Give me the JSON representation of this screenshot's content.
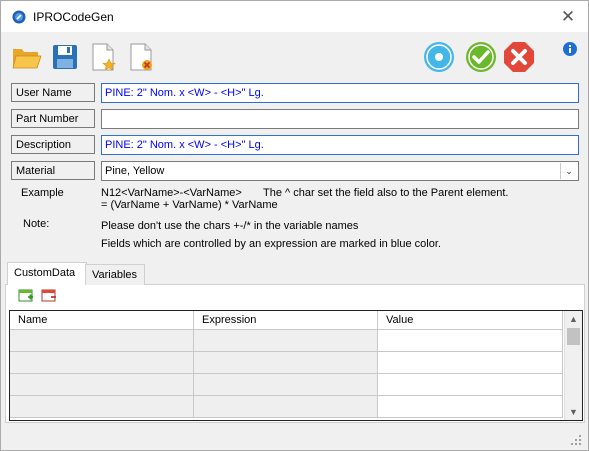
{
  "window": {
    "title": "IPROCodeGen"
  },
  "toolbar": {
    "open": "open-folder-icon",
    "save": "save-disk-icon",
    "new": "new-document-star-icon",
    "delete": "delete-document-icon",
    "status_blue": "info-circle-icon",
    "ok": "ok-check-icon",
    "cancel": "cancel-x-icon",
    "info": "info-icon"
  },
  "fields": {
    "user_name": {
      "label": "User Name",
      "value": "PINE: 2\" Nom. x <W> - <H>\" Lg."
    },
    "part_number": {
      "label": "Part Number",
      "value": ""
    },
    "description": {
      "label": "Description",
      "value": "PINE: 2\" Nom. x <W> - <H>\" Lg."
    },
    "material": {
      "label": "Material",
      "value": "Pine, Yellow"
    }
  },
  "notes": {
    "example_label": "Example",
    "example_line1": "N12<VarName>-<VarName>",
    "example_line1b": "The ^ char set the field also to the Parent element.",
    "example_line2": "= (VarName + VarName) * VarName",
    "note_label": "Note:",
    "note_line1": "Please don't use the chars +-/* in the variable names",
    "note_line2": "Fields which are controlled by an expression are marked in blue color."
  },
  "tabs": [
    {
      "label": "CustomData"
    },
    {
      "label": "Variables"
    }
  ],
  "grid": {
    "columns": [
      "Name",
      "Expression",
      "Value"
    ]
  },
  "colors": {
    "accent_blue": "#0000ff",
    "ok_green": "#6bb82a",
    "cancel_red": "#e2473a",
    "info_blue": "#45b6e8"
  }
}
